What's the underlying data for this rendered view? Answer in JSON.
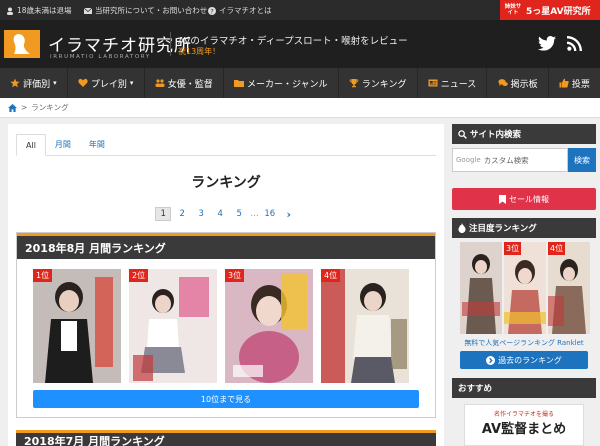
{
  "topbar": {
    "links": [
      "18歳未満は退場",
      "当研究所について・お問い合わせ",
      "イラマチオとは"
    ],
    "promo_small": "姉妹サイト",
    "promo_label": "5っ星AV研究所"
  },
  "header": {
    "logo_title": "イラマチオ研究所",
    "logo_sub": "IRRUMATIO LABORATORY",
    "tagline": "AVのイラマチオ・ディープスロート・喉射をレビュー",
    "tagline_sub": "祝13周年！"
  },
  "nav": {
    "items": [
      {
        "label": "評価別",
        "icon": "star-icon"
      },
      {
        "label": "プレイ別",
        "icon": "heart-icon"
      },
      {
        "label": "女優・監督",
        "icon": "users-icon"
      },
      {
        "label": "メーカー・ジャンル",
        "icon": "folder-icon"
      },
      {
        "label": "ランキング",
        "icon": "trophy-icon"
      },
      {
        "label": "ニュース",
        "icon": "newspaper-icon"
      },
      {
        "label": "掲示板",
        "icon": "comments-icon"
      },
      {
        "label": "投票",
        "icon": "thumbs-up-icon"
      }
    ]
  },
  "breadcrumb": {
    "current": "ランキング"
  },
  "main": {
    "tabs": [
      "All",
      "月間",
      "年間"
    ],
    "page_title": "ランキング",
    "pager": {
      "current": "1",
      "pages": [
        "2",
        "3",
        "4",
        "5"
      ],
      "dots": "…",
      "last": "16",
      "next": "›"
    },
    "block": {
      "title": "2018年8月 月間ランキング",
      "items": [
        {
          "rank": "1位",
          "color": "#5a4a44"
        },
        {
          "rank": "2位",
          "color": "#b88a8a"
        },
        {
          "rank": "3位",
          "color": "#c45a7a"
        },
        {
          "rank": "4位",
          "color": "#8a7a64"
        }
      ],
      "more_label": "10位まで見る"
    },
    "next_block_title": "2018年7月 月間ランキング"
  },
  "sidebar": {
    "search_title": "サイト内検索",
    "search_brand": "Google",
    "search_placeholder": "カスタム検索",
    "search_button": "検索",
    "sale_label": "セール情報",
    "hot_title": "注目度ランキング",
    "hot_items": [
      {
        "rank": "",
        "color": "#6a5a50"
      },
      {
        "rank": "3位",
        "color": "#c46a60"
      },
      {
        "rank": "4位",
        "color": "#8a6a5a"
      }
    ],
    "ranklet_text": "無料で人気ページランキング Ranklet",
    "past_label": "過去のランキング",
    "recommend_title": "おすすめ",
    "banner_small": "名作イラマチオを撮る",
    "banner_big": "AV監督まとめ"
  },
  "colors": {
    "accent": "#f19a22",
    "link": "#1e73be",
    "badge": "#e0261c"
  }
}
